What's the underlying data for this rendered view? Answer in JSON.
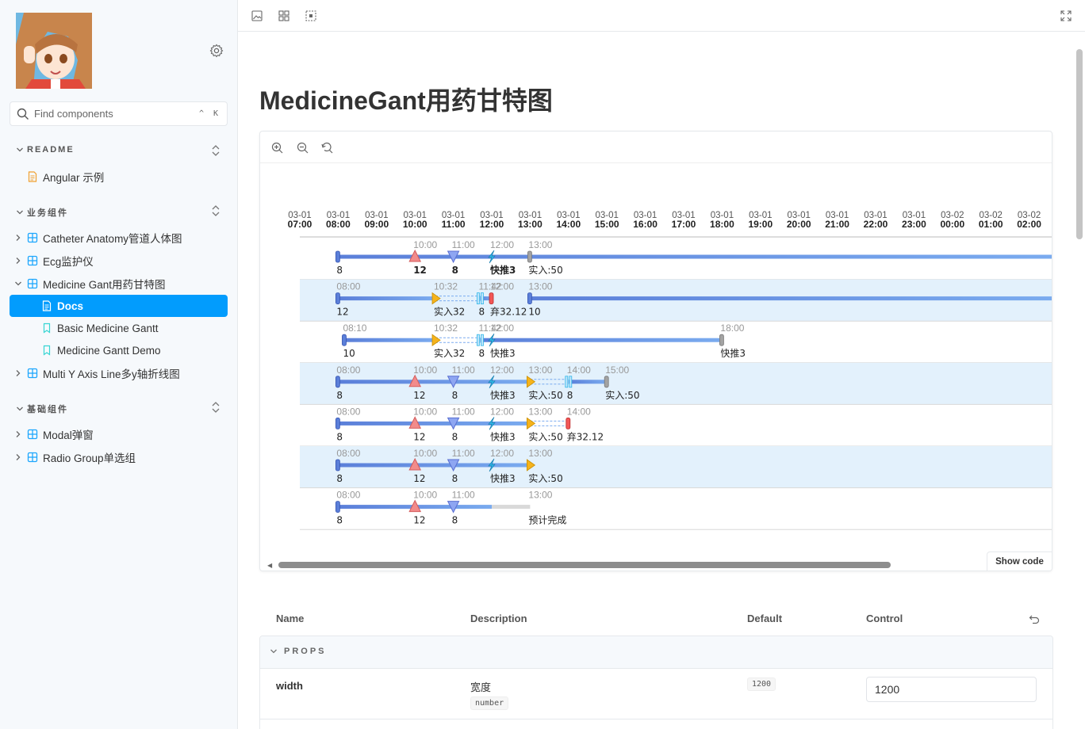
{
  "sidebar": {
    "search_placeholder": "Find components",
    "search_shortcut": "^ K",
    "sections": [
      {
        "title": "README"
      },
      {
        "title": "业务组件"
      },
      {
        "title": "基础组件"
      }
    ],
    "readme_items": [
      "Angular 示例"
    ],
    "biz_items": [
      "Catheter Anatomy管道人体图",
      "Ecg监护仪",
      "Medicine Gant用药甘特图"
    ],
    "gant_children": [
      "Docs",
      "Basic Medicine Gantt",
      "Medicine Gantt Demo"
    ],
    "biz_more": [
      "Multi Y Axis Line多y轴折线图"
    ],
    "base_items": [
      "Modal弹窗",
      "Radio Group单选组"
    ]
  },
  "page": {
    "title": "MedicineGant用药甘特图"
  },
  "preview": {
    "show_code": "Show code"
  },
  "chart_data": {
    "type": "gantt",
    "time_axis": [
      {
        "date": "03-01",
        "time": "07:00"
      },
      {
        "date": "03-01",
        "time": "08:00"
      },
      {
        "date": "03-01",
        "time": "09:00"
      },
      {
        "date": "03-01",
        "time": "10:00"
      },
      {
        "date": "03-01",
        "time": "11:00"
      },
      {
        "date": "03-01",
        "time": "12:00"
      },
      {
        "date": "03-01",
        "time": "13:00"
      },
      {
        "date": "03-01",
        "time": "14:00"
      },
      {
        "date": "03-01",
        "time": "15:00"
      },
      {
        "date": "03-01",
        "time": "16:00"
      },
      {
        "date": "03-01",
        "time": "17:00"
      },
      {
        "date": "03-01",
        "time": "18:00"
      },
      {
        "date": "03-01",
        "time": "19:00"
      },
      {
        "date": "03-01",
        "time": "20:00"
      },
      {
        "date": "03-01",
        "time": "21:00"
      },
      {
        "date": "03-01",
        "time": "22:00"
      },
      {
        "date": "03-01",
        "time": "23:00"
      },
      {
        "date": "03-02",
        "time": "00:00"
      },
      {
        "date": "03-02",
        "time": "01:00"
      },
      {
        "date": "03-02",
        "time": "02:00"
      }
    ],
    "rows": [
      {
        "start": "08:00",
        "end": "02:00+",
        "striped": false,
        "markers": [
          {
            "t": "08:00",
            "kind": "start",
            "label": "8"
          },
          {
            "t": "10:00",
            "kind": "up",
            "label": "12",
            "bold": true,
            "top": "10:00"
          },
          {
            "t": "11:00",
            "kind": "down",
            "label": "8",
            "bold": true,
            "top": "11:00"
          },
          {
            "t": "12:00",
            "kind": "bolt",
            "label": "快推3",
            "bold": true,
            "top": "12:00"
          },
          {
            "t": "13:00",
            "kind": "end-grey",
            "label": "实入:50",
            "top": "13:00"
          }
        ],
        "segments": [
          {
            "from": "08:00",
            "to": "02:00+",
            "style": "solid"
          }
        ]
      },
      {
        "start": "08:00",
        "striped": true,
        "markers": [
          {
            "t": "08:00",
            "kind": "start",
            "label": "12",
            "top": "08:00"
          },
          {
            "t": "10:32",
            "kind": "play",
            "label": "实入32",
            "top": "10:32"
          },
          {
            "t": "11:42",
            "kind": "pause",
            "label": "8",
            "top": "11:42"
          },
          {
            "t": "12:00",
            "kind": "stop-red",
            "label": "弃32.12",
            "top": "12:00"
          },
          {
            "t": "13:00",
            "kind": "start",
            "label": "10",
            "top": "13:00"
          }
        ],
        "segments": [
          {
            "from": "08:00",
            "to": "10:32",
            "style": "solid"
          },
          {
            "from": "10:32",
            "to": "11:42",
            "style": "dashed"
          },
          {
            "from": "11:42",
            "to": "12:00",
            "style": "solid"
          },
          {
            "from": "13:00",
            "to": "02:00+",
            "style": "solid"
          }
        ]
      },
      {
        "start": "08:10",
        "striped": false,
        "markers": [
          {
            "t": "08:10",
            "kind": "start",
            "label": "10",
            "top": "08:10"
          },
          {
            "t": "10:32",
            "kind": "play",
            "label": "实入32",
            "top": "10:32"
          },
          {
            "t": "11:42",
            "kind": "pause",
            "label": "8",
            "top": "11:42"
          },
          {
            "t": "12:00",
            "kind": "bolt",
            "label": "快推3",
            "top": "12:00"
          },
          {
            "t": "18:00",
            "kind": "end-grey",
            "label": "快推3",
            "top": "18:00"
          }
        ],
        "segments": [
          {
            "from": "08:10",
            "to": "10:32",
            "style": "solid"
          },
          {
            "from": "10:32",
            "to": "11:42",
            "style": "dashed"
          },
          {
            "from": "11:42",
            "to": "18:00",
            "style": "solid"
          }
        ]
      },
      {
        "start": "08:00",
        "striped": true,
        "markers": [
          {
            "t": "08:00",
            "kind": "start",
            "label": "8",
            "top": "08:00"
          },
          {
            "t": "10:00",
            "kind": "up",
            "label": "12",
            "top": "10:00"
          },
          {
            "t": "11:00",
            "kind": "down",
            "label": "8",
            "top": "11:00"
          },
          {
            "t": "12:00",
            "kind": "bolt",
            "label": "快推3",
            "top": "12:00"
          },
          {
            "t": "13:00",
            "kind": "play",
            "label": "实入:50",
            "top": "13:00"
          },
          {
            "t": "14:00",
            "kind": "pause",
            "label": "8",
            "top": "14:00"
          },
          {
            "t": "15:00",
            "kind": "end-grey",
            "label": "实入:50",
            "top": "15:00"
          }
        ],
        "segments": [
          {
            "from": "08:00",
            "to": "13:00",
            "style": "solid"
          },
          {
            "from": "13:00",
            "to": "14:00",
            "style": "dashed"
          },
          {
            "from": "14:00",
            "to": "15:00",
            "style": "solid"
          }
        ]
      },
      {
        "start": "08:00",
        "striped": false,
        "markers": [
          {
            "t": "08:00",
            "kind": "start",
            "label": "8",
            "top": "08:00"
          },
          {
            "t": "10:00",
            "kind": "up",
            "label": "12",
            "top": "10:00"
          },
          {
            "t": "11:00",
            "kind": "down",
            "label": "8",
            "top": "11:00"
          },
          {
            "t": "12:00",
            "kind": "bolt",
            "label": "快推3",
            "top": "12:00"
          },
          {
            "t": "13:00",
            "kind": "play",
            "label": "实入:50",
            "top": "13:00"
          },
          {
            "t": "14:00",
            "kind": "stop-red",
            "label": "弃32.12",
            "top": "14:00"
          }
        ],
        "segments": [
          {
            "from": "08:00",
            "to": "13:00",
            "style": "solid"
          },
          {
            "from": "13:00",
            "to": "14:00",
            "style": "dashed"
          }
        ]
      },
      {
        "start": "08:00",
        "striped": true,
        "markers": [
          {
            "t": "08:00",
            "kind": "start",
            "label": "8",
            "top": "08:00"
          },
          {
            "t": "10:00",
            "kind": "up",
            "label": "12",
            "top": "10:00"
          },
          {
            "t": "11:00",
            "kind": "down",
            "label": "8",
            "top": "11:00"
          },
          {
            "t": "12:00",
            "kind": "bolt",
            "label": "快推3",
            "top": "12:00"
          },
          {
            "t": "13:00",
            "kind": "play",
            "label": "实入:50",
            "top": "13:00"
          }
        ],
        "segments": [
          {
            "from": "08:00",
            "to": "13:00",
            "style": "solid"
          }
        ]
      },
      {
        "start": "08:00",
        "striped": false,
        "markers": [
          {
            "t": "08:00",
            "kind": "start",
            "label": "8",
            "top": "08:00"
          },
          {
            "t": "10:00",
            "kind": "up",
            "label": "12",
            "top": "10:00"
          },
          {
            "t": "11:00",
            "kind": "down",
            "label": "8",
            "top": "11:00"
          },
          {
            "t": "13:00",
            "kind": "none",
            "label": "预计完成",
            "top": "13:00"
          }
        ],
        "segments": [
          {
            "from": "08:00",
            "to": "12:00",
            "style": "solid"
          },
          {
            "from": "12:00",
            "to": "13:00",
            "style": "pending"
          }
        ]
      }
    ],
    "colors": {
      "bar": "#5b7fd9",
      "bar_light": "#7aabef",
      "up": "#f28b8b",
      "down": "#8ea6f2",
      "bolt": "#2fb7e8",
      "play": "#f5b31c",
      "stop": "#f25757",
      "grey": "#a3a3a3",
      "stripe": "#e3f1fc",
      "pending": "#d9d9d9"
    }
  },
  "props_table": {
    "headers": {
      "name": "Name",
      "description": "Description",
      "default": "Default",
      "control": "Control"
    },
    "group": "PROPS",
    "rows": [
      {
        "name": "width",
        "description": "宽度",
        "type": "number",
        "default": "1200",
        "value": "1200"
      }
    ]
  }
}
